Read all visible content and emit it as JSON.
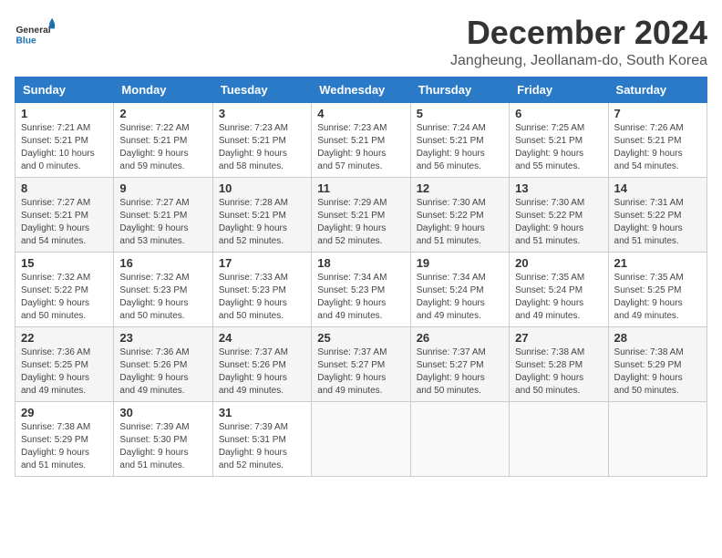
{
  "header": {
    "logo_general": "General",
    "logo_blue": "Blue",
    "month": "December 2024",
    "location": "Jangheung, Jeollanam-do, South Korea"
  },
  "columns": [
    "Sunday",
    "Monday",
    "Tuesday",
    "Wednesday",
    "Thursday",
    "Friday",
    "Saturday"
  ],
  "weeks": [
    [
      {
        "day": "1",
        "info": "Sunrise: 7:21 AM\nSunset: 5:21 PM\nDaylight: 10 hours\nand 0 minutes."
      },
      {
        "day": "2",
        "info": "Sunrise: 7:22 AM\nSunset: 5:21 PM\nDaylight: 9 hours\nand 59 minutes."
      },
      {
        "day": "3",
        "info": "Sunrise: 7:23 AM\nSunset: 5:21 PM\nDaylight: 9 hours\nand 58 minutes."
      },
      {
        "day": "4",
        "info": "Sunrise: 7:23 AM\nSunset: 5:21 PM\nDaylight: 9 hours\nand 57 minutes."
      },
      {
        "day": "5",
        "info": "Sunrise: 7:24 AM\nSunset: 5:21 PM\nDaylight: 9 hours\nand 56 minutes."
      },
      {
        "day": "6",
        "info": "Sunrise: 7:25 AM\nSunset: 5:21 PM\nDaylight: 9 hours\nand 55 minutes."
      },
      {
        "day": "7",
        "info": "Sunrise: 7:26 AM\nSunset: 5:21 PM\nDaylight: 9 hours\nand 54 minutes."
      }
    ],
    [
      {
        "day": "8",
        "info": "Sunrise: 7:27 AM\nSunset: 5:21 PM\nDaylight: 9 hours\nand 54 minutes."
      },
      {
        "day": "9",
        "info": "Sunrise: 7:27 AM\nSunset: 5:21 PM\nDaylight: 9 hours\nand 53 minutes."
      },
      {
        "day": "10",
        "info": "Sunrise: 7:28 AM\nSunset: 5:21 PM\nDaylight: 9 hours\nand 52 minutes."
      },
      {
        "day": "11",
        "info": "Sunrise: 7:29 AM\nSunset: 5:21 PM\nDaylight: 9 hours\nand 52 minutes."
      },
      {
        "day": "12",
        "info": "Sunrise: 7:30 AM\nSunset: 5:22 PM\nDaylight: 9 hours\nand 51 minutes."
      },
      {
        "day": "13",
        "info": "Sunrise: 7:30 AM\nSunset: 5:22 PM\nDaylight: 9 hours\nand 51 minutes."
      },
      {
        "day": "14",
        "info": "Sunrise: 7:31 AM\nSunset: 5:22 PM\nDaylight: 9 hours\nand 51 minutes."
      }
    ],
    [
      {
        "day": "15",
        "info": "Sunrise: 7:32 AM\nSunset: 5:22 PM\nDaylight: 9 hours\nand 50 minutes."
      },
      {
        "day": "16",
        "info": "Sunrise: 7:32 AM\nSunset: 5:23 PM\nDaylight: 9 hours\nand 50 minutes."
      },
      {
        "day": "17",
        "info": "Sunrise: 7:33 AM\nSunset: 5:23 PM\nDaylight: 9 hours\nand 50 minutes."
      },
      {
        "day": "18",
        "info": "Sunrise: 7:34 AM\nSunset: 5:23 PM\nDaylight: 9 hours\nand 49 minutes."
      },
      {
        "day": "19",
        "info": "Sunrise: 7:34 AM\nSunset: 5:24 PM\nDaylight: 9 hours\nand 49 minutes."
      },
      {
        "day": "20",
        "info": "Sunrise: 7:35 AM\nSunset: 5:24 PM\nDaylight: 9 hours\nand 49 minutes."
      },
      {
        "day": "21",
        "info": "Sunrise: 7:35 AM\nSunset: 5:25 PM\nDaylight: 9 hours\nand 49 minutes."
      }
    ],
    [
      {
        "day": "22",
        "info": "Sunrise: 7:36 AM\nSunset: 5:25 PM\nDaylight: 9 hours\nand 49 minutes."
      },
      {
        "day": "23",
        "info": "Sunrise: 7:36 AM\nSunset: 5:26 PM\nDaylight: 9 hours\nand 49 minutes."
      },
      {
        "day": "24",
        "info": "Sunrise: 7:37 AM\nSunset: 5:26 PM\nDaylight: 9 hours\nand 49 minutes."
      },
      {
        "day": "25",
        "info": "Sunrise: 7:37 AM\nSunset: 5:27 PM\nDaylight: 9 hours\nand 49 minutes."
      },
      {
        "day": "26",
        "info": "Sunrise: 7:37 AM\nSunset: 5:27 PM\nDaylight: 9 hours\nand 50 minutes."
      },
      {
        "day": "27",
        "info": "Sunrise: 7:38 AM\nSunset: 5:28 PM\nDaylight: 9 hours\nand 50 minutes."
      },
      {
        "day": "28",
        "info": "Sunrise: 7:38 AM\nSunset: 5:29 PM\nDaylight: 9 hours\nand 50 minutes."
      }
    ],
    [
      {
        "day": "29",
        "info": "Sunrise: 7:38 AM\nSunset: 5:29 PM\nDaylight: 9 hours\nand 51 minutes."
      },
      {
        "day": "30",
        "info": "Sunrise: 7:39 AM\nSunset: 5:30 PM\nDaylight: 9 hours\nand 51 minutes."
      },
      {
        "day": "31",
        "info": "Sunrise: 7:39 AM\nSunset: 5:31 PM\nDaylight: 9 hours\nand 52 minutes."
      },
      {
        "day": "",
        "info": ""
      },
      {
        "day": "",
        "info": ""
      },
      {
        "day": "",
        "info": ""
      },
      {
        "day": "",
        "info": ""
      }
    ]
  ]
}
